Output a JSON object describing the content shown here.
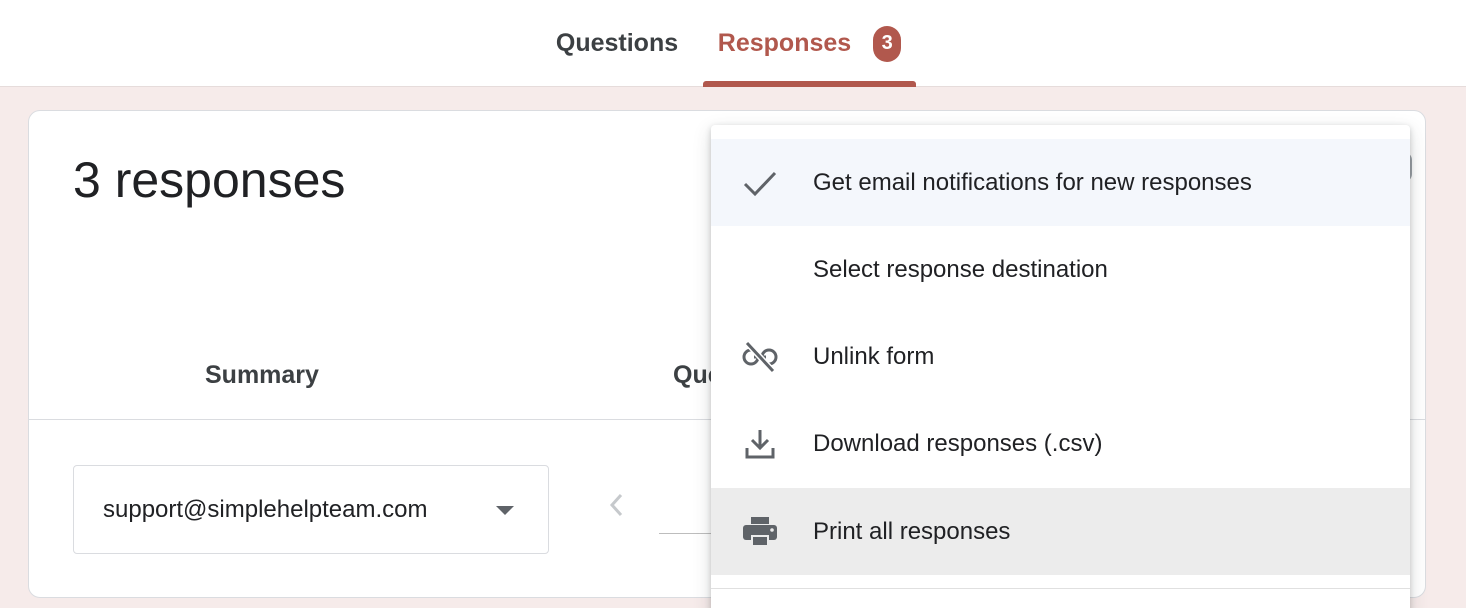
{
  "tabs": {
    "questions_label": "Questions",
    "responses_label": "Responses",
    "responses_badge": "3"
  },
  "card": {
    "title": "3 responses",
    "subtab_summary": "Summary",
    "subtab_question": "Question",
    "responder_select": {
      "value": "support@simplehelpteam.com"
    }
  },
  "menu": {
    "items": [
      {
        "label": "Get email notifications for new responses",
        "icon": "check-icon",
        "checked": true
      },
      {
        "label": "Select response destination",
        "icon": ""
      },
      {
        "label": "Unlink form",
        "icon": "link-off-icon"
      },
      {
        "label": "Download responses (.csv)",
        "icon": "download-icon"
      },
      {
        "label": "Print all responses",
        "icon": "print-icon"
      }
    ]
  },
  "colors": {
    "accent": "#b1584d",
    "page_background": "#f6ebea",
    "hover_item": "#ececec",
    "checked_item": "#f4f7fc"
  }
}
